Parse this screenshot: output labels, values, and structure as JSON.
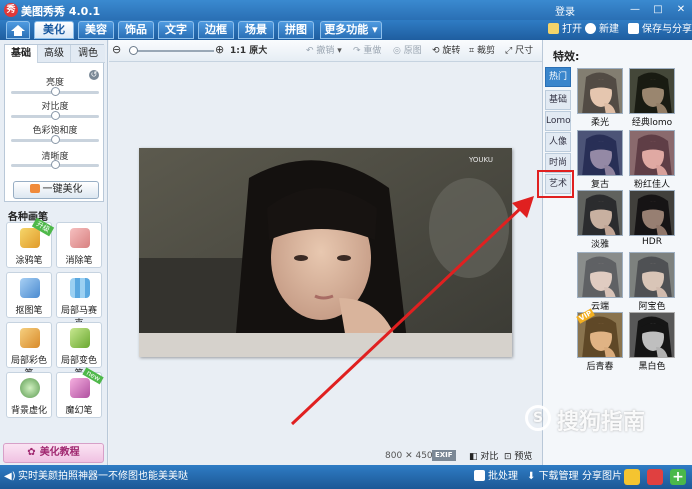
{
  "app": {
    "logo_glyph": "秀",
    "title": "美图秀秀 4.0.1",
    "login": "登录"
  },
  "window_buttons": [
    "—",
    "□",
    "✕"
  ],
  "menu": {
    "tabs": [
      "美化",
      "美容",
      "饰品",
      "文字",
      "边框",
      "场景",
      "拼图",
      "更多功能 ▾"
    ],
    "active_tab": "美化",
    "open": "打开",
    "new": "新建",
    "save_share": "保存与分享"
  },
  "left_panel": {
    "subtabs": [
      "基础",
      "高级",
      "调色"
    ],
    "sliders": [
      {
        "label": "亮度",
        "level": 0.5
      },
      {
        "label": "对比度",
        "level": 0.5
      },
      {
        "label": "色彩饱和度",
        "level": 0.5
      },
      {
        "label": "清晰度",
        "level": 0.5
      }
    ],
    "one_click": "一键美化",
    "brush_title": "各种画笔",
    "tools": [
      {
        "label": "涂鸦笔",
        "badge": "升级",
        "color": "#f2c050"
      },
      {
        "label": "消除笔",
        "badge": "",
        "color": "#e8a0a0"
      },
      {
        "label": "抠图笔",
        "badge": "",
        "color": "#70a8e0"
      },
      {
        "label": "局部马赛克",
        "badge": "",
        "color": "#7bbbe8"
      },
      {
        "label": "局部彩色笔",
        "badge": "",
        "color": "#e8b050"
      },
      {
        "label": "局部变色笔",
        "badge": "",
        "color": "#90c850"
      },
      {
        "label": "背景虚化",
        "badge": "",
        "color": "#70b070"
      },
      {
        "label": "魔幻笔",
        "badge": "new",
        "color": "#e080c0"
      }
    ],
    "tutorial": "美化教程"
  },
  "edit_toolbar": {
    "zoom_level": 0.0,
    "actual_size": "1:1 原大",
    "undo": "撤销",
    "redo": "重做",
    "original": "原图",
    "rotate": "旋转",
    "crop": "裁剪",
    "resize": "尺寸"
  },
  "canvas": {
    "photo_watermark": "YOUKU",
    "width_text": "800",
    "times": "✕",
    "height_text": "450",
    "exif": "EXIF",
    "compare": "对比",
    "preview": "预览"
  },
  "right_panel": {
    "title": "特效:",
    "categories": [
      "热门",
      "基础",
      "Lomo",
      "人像",
      "时尚",
      "艺术"
    ],
    "active_category": "热门",
    "highlighted_category": "艺术",
    "effects": [
      {
        "label": "柔光",
        "tint": "rgba(255,240,220,0.25)"
      },
      {
        "label": "经典lomo",
        "tint": "rgba(30,40,20,0.35)"
      },
      {
        "label": "复古",
        "tint": "rgba(60,80,170,0.45)"
      },
      {
        "label": "粉红佳人",
        "tint": "rgba(230,140,170,0.35)"
      },
      {
        "label": "淡雅",
        "tint": "rgba(120,140,160,0.2)"
      },
      {
        "label": "HDR",
        "tint": "rgba(20,20,30,0.35)"
      },
      {
        "label": "云端",
        "tint": "rgba(230,240,255,0.35)"
      },
      {
        "label": "阿宝色",
        "tint": "rgba(210,225,240,0.3)"
      },
      {
        "label": "后青春",
        "tint": "rgba(230,170,80,0.35)"
      },
      {
        "label": "黑白色",
        "tint": "grayscale"
      }
    ],
    "vip_badge": "VIP"
  },
  "status": {
    "hint": "实时美颜拍照神器一不修图也能美美哒",
    "batch": "批处理",
    "download": "下载管理",
    "share": "分享图片"
  },
  "watermark": {
    "circle": "S",
    "text": "搜狗指南"
  }
}
